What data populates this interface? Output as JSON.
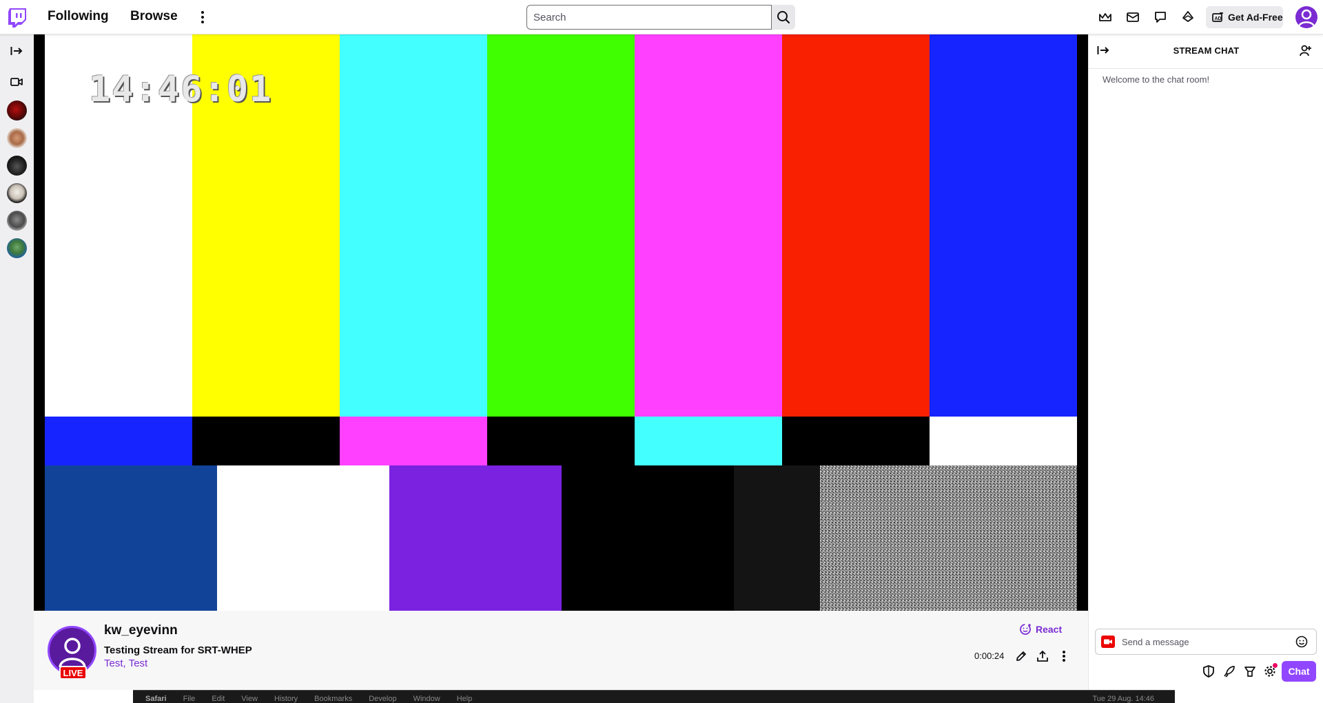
{
  "nav": {
    "following": "Following",
    "browse": "Browse",
    "search_placeholder": "Search",
    "get_ad_free": "Get Ad-Free"
  },
  "player": {
    "clock": "14:46:01"
  },
  "channel": {
    "name": "kw_eyevinn",
    "live_badge": "LIVE",
    "stream_title": "Testing Stream for SRT-WHEP",
    "tags": [
      "Test,",
      "Test"
    ],
    "react_label": "React",
    "uptime": "0:00:24"
  },
  "chat": {
    "title": "STREAM CHAT",
    "welcome": "Welcome to the chat room!",
    "placeholder": "Send a message",
    "send_label": "Chat"
  },
  "dock": {
    "menu": [
      "Safari",
      "File",
      "Edit",
      "View",
      "History",
      "Bookmarks",
      "Develop",
      "Window",
      "Help"
    ],
    "clock": "Tue 29 Aug. 14:46"
  },
  "colors": {
    "brand": "#9147ff",
    "live": "#eb0400",
    "link": "#7b2bd2"
  },
  "icons": [
    "twitch-logo",
    "more-icon",
    "search-icon",
    "crown-icon",
    "inbox-icon",
    "whispers-icon",
    "bits-icon",
    "ad-free-icon",
    "collapse-icon",
    "camera-icon",
    "react-icon",
    "edit-icon",
    "share-icon",
    "users-icon",
    "emote-icon",
    "shield-icon",
    "rocket-icon",
    "ticket-icon",
    "gear-icon"
  ]
}
